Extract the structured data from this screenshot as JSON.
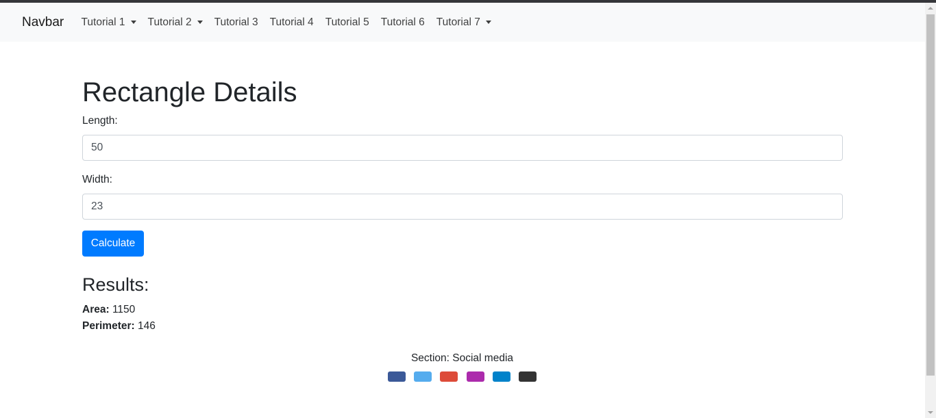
{
  "navbar": {
    "brand": "Navbar",
    "items": [
      {
        "label": "Tutorial 1",
        "dropdown": true
      },
      {
        "label": "Tutorial 2",
        "dropdown": true
      },
      {
        "label": "Tutorial 3",
        "dropdown": false
      },
      {
        "label": "Tutorial 4",
        "dropdown": false
      },
      {
        "label": "Tutorial 5",
        "dropdown": false
      },
      {
        "label": "Tutorial 6",
        "dropdown": false
      },
      {
        "label": "Tutorial 7",
        "dropdown": true
      }
    ]
  },
  "form": {
    "title": "Rectangle Details",
    "length_label": "Length:",
    "length_value": "50",
    "width_label": "Width:",
    "width_value": "23",
    "calculate_label": "Calculate"
  },
  "results": {
    "heading": "Results:",
    "area_label": "Area:",
    "area_value": "1150",
    "perimeter_label": "Perimeter:",
    "perimeter_value": "146"
  },
  "footer": {
    "section_label": "Section: Social media",
    "social_buttons": [
      {
        "name": "facebook",
        "color": "#3b5998"
      },
      {
        "name": "twitter",
        "color": "#55acee"
      },
      {
        "name": "google",
        "color": "#dd4b39"
      },
      {
        "name": "instagram",
        "color": "#ac2bac"
      },
      {
        "name": "linkedin",
        "color": "#0082ca"
      },
      {
        "name": "github",
        "color": "#333333"
      }
    ]
  },
  "colors": {
    "primary": "#007bff",
    "navbar_bg": "#f8f9fa"
  }
}
